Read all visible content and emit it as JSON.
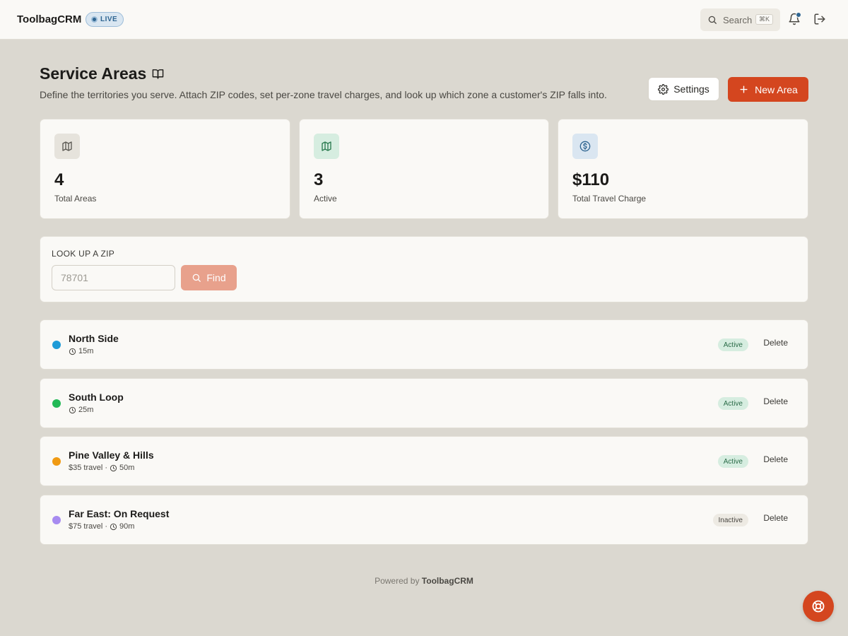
{
  "app": {
    "brand": "ToolbagCRM",
    "live_label": "LIVE"
  },
  "topbar": {
    "search_label": "Search",
    "search_shortcut": "⌘K",
    "icons": [
      "search-icon",
      "bell-icon",
      "logout-icon"
    ]
  },
  "header": {
    "title": "Service Areas",
    "description": "Define the territories you serve. Attach ZIP codes, set per-zone travel charges, and look up which zone a customer's ZIP falls into.",
    "settings_label": "Settings",
    "new_area_label": "New Area"
  },
  "stats": [
    {
      "value": "4",
      "label": "Total Areas",
      "icon": "map-icon",
      "icon_bg": "#e6e3dc",
      "icon_color": "#5a5852"
    },
    {
      "value": "3",
      "label": "Active",
      "icon": "map-icon",
      "icon_bg": "#d6ede0",
      "icon_color": "#2a7a4f"
    },
    {
      "value": "$110",
      "label": "Total Travel Charge",
      "icon": "dollar-icon",
      "icon_bg": "#dae6f1",
      "icon_color": "#2f6591"
    }
  ],
  "zip_lookup": {
    "label": "LOOK UP A ZIP",
    "placeholder": "78701",
    "find_label": "Find"
  },
  "areas": [
    {
      "name": "North Side",
      "travel": "",
      "time": "15m",
      "status": "Active",
      "color": "#1e9bd7",
      "delete_label": "Delete"
    },
    {
      "name": "South Loop",
      "travel": "",
      "time": "25m",
      "status": "Active",
      "color": "#22b956",
      "delete_label": "Delete"
    },
    {
      "name": "Pine Valley & Hills",
      "travel": "$35 travel",
      "time": "50m",
      "status": "Active",
      "color": "#f09a12",
      "delete_label": "Delete"
    },
    {
      "name": "Far East: On Request",
      "travel": "$75 travel",
      "time": "90m",
      "status": "Inactive",
      "color": "#a78bf0",
      "delete_label": "Delete"
    }
  ],
  "footer": {
    "prefix": "Powered by",
    "brand": "ToolbagCRM"
  },
  "colors": {
    "accent": "#d4461f",
    "background": "#dbd8d0",
    "surface": "#faf9f6"
  }
}
